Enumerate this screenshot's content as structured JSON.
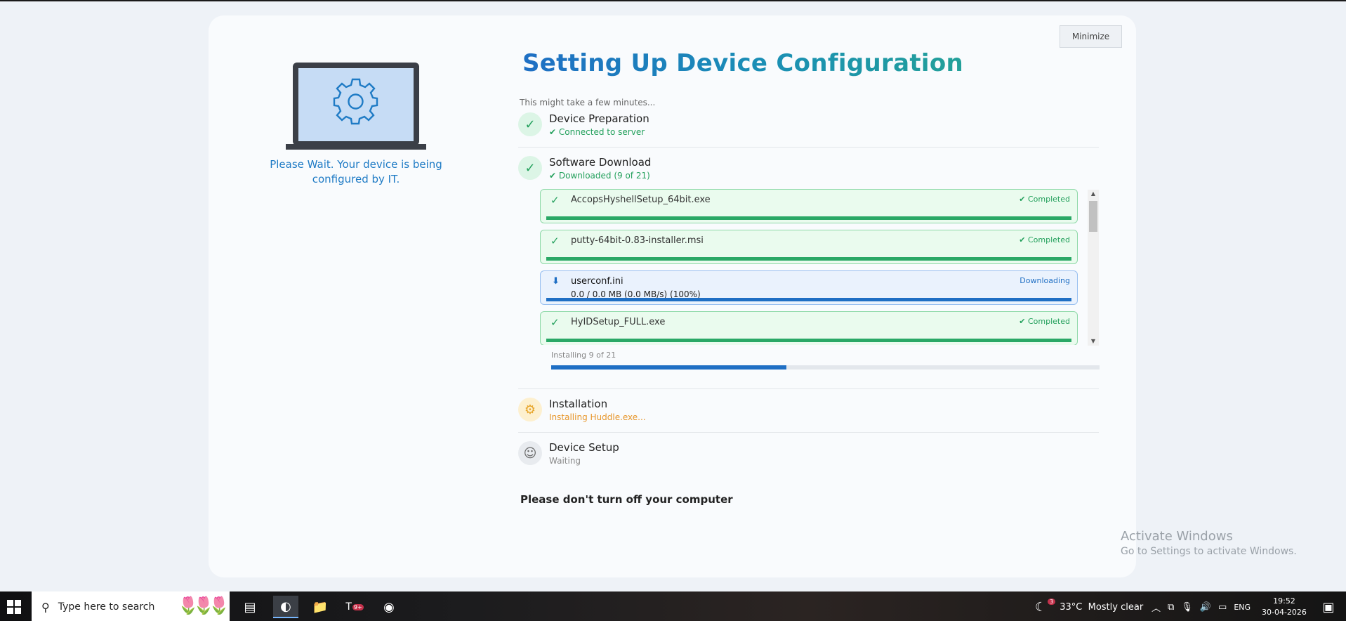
{
  "window": {
    "minimize_label": "Minimize"
  },
  "left": {
    "wait_message": "Please Wait. Your device is being configured by IT."
  },
  "header": {
    "title": "Setting Up Device Configuration",
    "subtitle": "This might take a few minutes..."
  },
  "steps": {
    "preparation": {
      "title": "Device Preparation",
      "status": "✔ Connected to server",
      "icon": "✓"
    },
    "download": {
      "title": "Software Download",
      "status": "✔ Downloaded (9 of 21)",
      "icon": "✓"
    },
    "installation": {
      "title": "Installation",
      "status": "Installing Huddle.exe...",
      "icon": "⚙"
    },
    "setup": {
      "title": "Device Setup",
      "status": "Waiting",
      "icon": "☺"
    }
  },
  "downloads": [
    {
      "name": "AccopsHyshellSetup_64bit.exe",
      "state": "✔ Completed",
      "detail": "",
      "icon": "✓",
      "progress": 100
    },
    {
      "name": "putty-64bit-0.83-installer.msi",
      "state": "✔ Completed",
      "detail": "",
      "icon": "✓",
      "progress": 100
    },
    {
      "name": "userconf.ini",
      "state": "Downloading",
      "detail": "0.0 / 0.0 MB (0.0 MB/s) (100%)",
      "icon": "⬇",
      "progress": 100
    },
    {
      "name": "HyIDSetup_FULL.exe",
      "state": "✔ Completed",
      "detail": "",
      "icon": "✓",
      "progress": 100
    }
  ],
  "install_progress": {
    "label": "Installing 9 of 21",
    "fraction": 0.4286
  },
  "warning": "Please don't turn off your computer",
  "watermark": {
    "line1": "Activate Windows",
    "line2": "Go to Settings to activate Windows."
  },
  "taskbar": {
    "search_placeholder": "Type here to search",
    "weather": "33°C  Mostly clear",
    "weather_badge": "3",
    "language": "ENG",
    "time": "19:52",
    "date": "30-04-2026",
    "teams_badge": "9+"
  },
  "colors": {
    "accent_blue": "#1f6fc4",
    "success_green": "#23a05c",
    "warning_orange": "#e7962a"
  }
}
